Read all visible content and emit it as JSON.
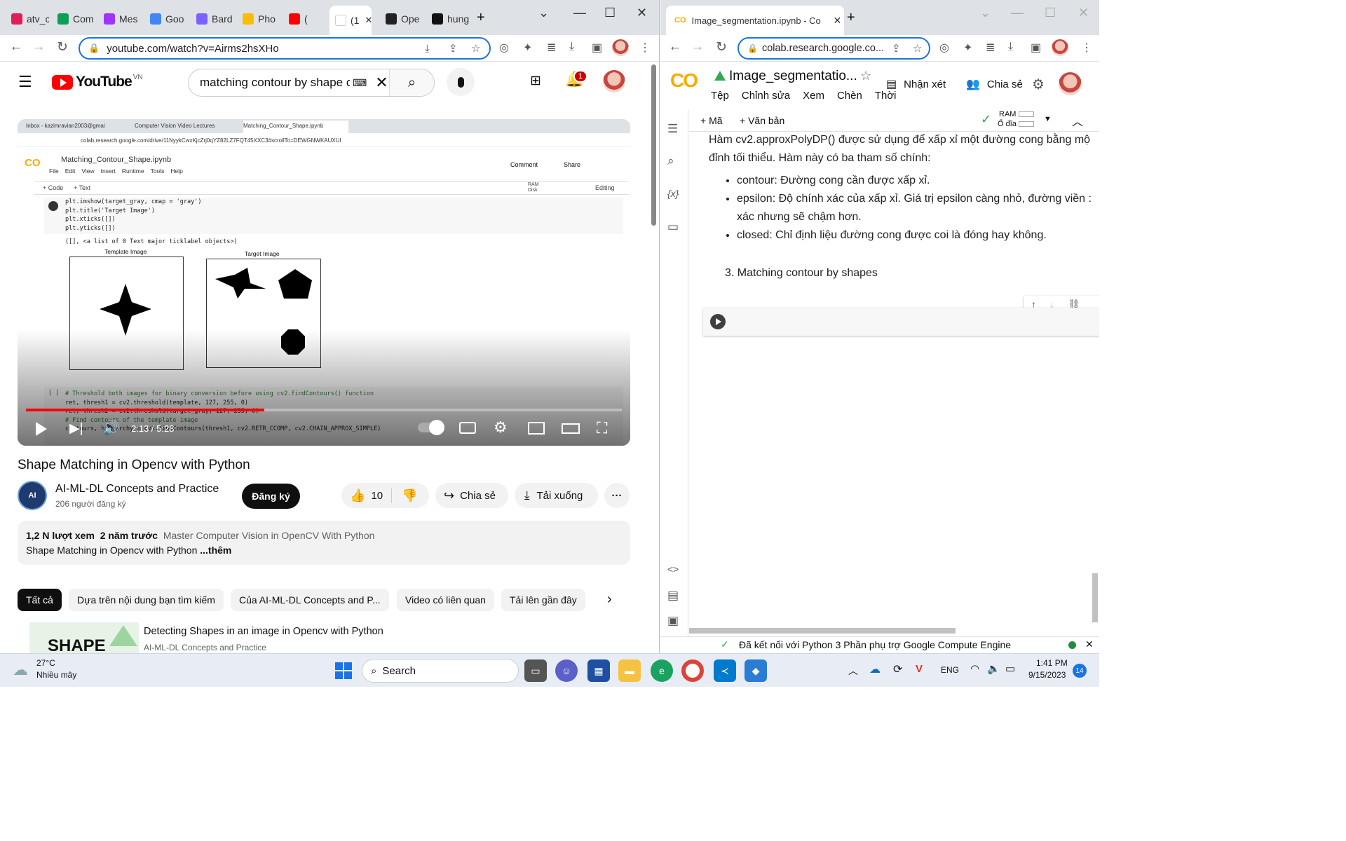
{
  "left_browser": {
    "tabs": [
      {
        "label": "atv_c",
        "color": "#e01e5a"
      },
      {
        "label": "Com",
        "color": "#0f9d58"
      },
      {
        "label": "Mes",
        "color": "#a033ff"
      },
      {
        "label": "Goo",
        "color": "#4285f4"
      },
      {
        "label": "Bard",
        "color": "#7b61ff"
      },
      {
        "label": "Pho",
        "color": "#fbbc04"
      },
      {
        "label": "(",
        "color": "#ff0000"
      },
      {
        "label": "(1",
        "color": "#ffffff"
      },
      {
        "label": "Ope",
        "color": "#222222"
      },
      {
        "label": "hung",
        "color": "#111111"
      }
    ],
    "url": "youtube.com/watch?v=Airms2hsXHo"
  },
  "youtube": {
    "logo": "YouTube",
    "country": "VN",
    "search_value": "matching contour by shape o",
    "notif_count": "1",
    "video_title": "Shape Matching in Opencv with Python",
    "channel_name": "AI-ML-DL Concepts and Practice",
    "channel_avatar_text": "AI",
    "subscribers": "206 người đăng ký",
    "subscribe_label": "Đăng ký",
    "like_count": "10",
    "share_label": "Chia sẻ",
    "download_label": "Tải xuống",
    "more_label": "···",
    "views": "1,2 N lượt xem",
    "age": "2 năm trước",
    "playlist": "Master Computer Vision in OpenCV With Python",
    "description": "Shape Matching in Opencv with Python",
    "more_link": "...thêm",
    "chips": [
      "Tất cả",
      "Dựa trên nội dung bạn tìm kiếm",
      "Của AI-ML-DL Concepts and P...",
      "Video có liên quan",
      "Tải lên gần đây"
    ],
    "rec_title": "Detecting Shapes in an image in Opencv with Python",
    "rec_channel": "AI-ML-DL Concepts and Practice",
    "rec_thumb_text": "SHAPE",
    "player": {
      "time": "2:13 / 5:28",
      "progress": 0.4
    }
  },
  "video_content": {
    "tabs": [
      "Inbox - kazimravian2003@gmai",
      "Computer Vision Video Lectures",
      "Matching_Contour_Shape.ipynb"
    ],
    "url": "colab.research.google.com/drive/11NyykCwxKjcZrj0qYZ82LZ7FQT45XXC3#scrollTo=DEWGNWKAUXUI",
    "notebook": "Matching_Contour_Shape.ipynb",
    "menu": [
      "File",
      "Edit",
      "View",
      "Insert",
      "Runtime",
      "Tools",
      "Help"
    ],
    "comment": "Comment",
    "share": "Share",
    "code_btn": "+ Code",
    "text_btn": "+ Text",
    "ram": "RAM",
    "disk": "Disk",
    "editing": "Editing",
    "code_lines": [
      "plt.imshow(target_gray, cmap = 'gray')",
      "plt.title('Target Image')",
      "plt.xticks([])",
      "plt.yticks([])"
    ],
    "output": "([], <a list of 0 Text major ticklabel objects>)",
    "template_title": "Template Image",
    "target_title": "Target Image",
    "cell2_prefix": "[ ]",
    "cell2_lines": [
      "# Threshold both images for binary conversion before using cv2.findContours() function",
      "ret, thresh1 = cv2.threshold(template, 127, 255, 0)",
      "ret, thresh2 = cv2.threshold(target_gray, 127, 255, 0)",
      "# Find contours of the template image",
      "contours, hierarchy = cv2.findContours(thresh1, cv2.RETR_CCOMP, cv2.CHAIN_APPROX_SIMPLE)"
    ]
  },
  "right_browser": {
    "tab_title": "Image_segmentation.ipynb - Co",
    "url": "colab.research.google.co...",
    "notebook_name": "Image_segmentatio...",
    "menu": [
      "Tệp",
      "Chỉnh sửa",
      "Xem",
      "Chèn",
      "Thời"
    ],
    "comment_label": "Nhận xét",
    "share_label": "Chia sẻ",
    "add_code": "+ Mã",
    "add_text": "+ Văn bản",
    "ram": "RAM",
    "disk": "Ổ đĩa",
    "text_para": "Hàm cv2.approxPolyDP() được sử dụng để xấp xỉ một đường cong bằng mộ đỉnh tối thiểu. Hàm này có ba tham số chính:",
    "bullets": [
      "contour: Đường cong cần được xấp xỉ.",
      "epsilon: Độ chính xác của xấp xỉ. Giá trị epsilon càng nhỏ, đường viền : xác nhưng sẽ chậm hơn.",
      "closed: Chỉ định liệu đường cong được coi là đóng hay không."
    ],
    "heading": "3. Matching contour by shapes",
    "status": "Đã kết nối với Python 3 Phần phụ trợ Google Compute Engine"
  },
  "taskbar": {
    "temp": "27°C",
    "weather": "Nhiều mây",
    "search": "Search",
    "lang": "ENG",
    "time": "1:41 PM",
    "date": "9/15/2023",
    "notif": "14"
  }
}
